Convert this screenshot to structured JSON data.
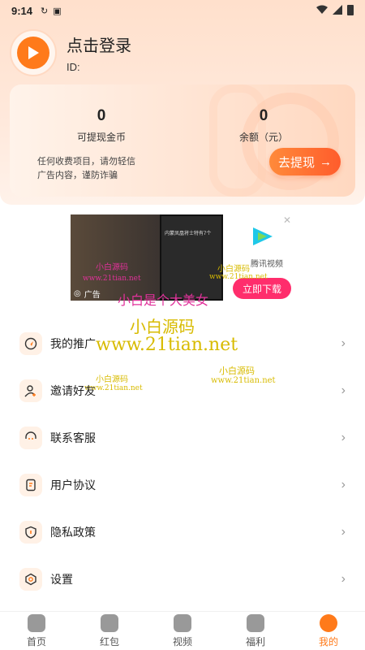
{
  "status_bar": {
    "time": "9:14"
  },
  "profile": {
    "login_text": "点击登录",
    "id_label": "ID:"
  },
  "coin_card": {
    "coins_value": "0",
    "coins_label": "可提现金币",
    "balance_value": "0",
    "balance_label": "余额（元）",
    "notice_line1": "任何收费项目，请勿轻信",
    "notice_line2": "广告内容，谨防诈骗",
    "withdraw_label": "去提现"
  },
  "ad": {
    "badge": "广告",
    "app_name": "腾讯视频",
    "download_label": "立即下载",
    "phone_text": "内蒙凤凰将士特有7个"
  },
  "watermarks": {
    "w1": "小白源码",
    "w2": "www.21tian.net",
    "w3": "小白是个大美女",
    "w6": "小白源码",
    "w7": "www.21tian.net"
  },
  "menu": {
    "items": [
      {
        "label": "我的推广",
        "icon": "send-icon"
      },
      {
        "label": "邀请好友",
        "icon": "add-user-icon"
      },
      {
        "label": "联系客服",
        "icon": "headset-icon"
      },
      {
        "label": "用户协议",
        "icon": "document-icon"
      },
      {
        "label": "隐私政策",
        "icon": "shield-icon"
      },
      {
        "label": "设置",
        "icon": "settings-icon"
      }
    ]
  },
  "tabs": [
    {
      "label": "首页",
      "icon": "home-icon"
    },
    {
      "label": "红包",
      "icon": "red-envelope-icon"
    },
    {
      "label": "视频",
      "icon": "video-icon"
    },
    {
      "label": "福利",
      "icon": "gift-icon"
    },
    {
      "label": "我的",
      "icon": "user-icon"
    }
  ],
  "colors": {
    "accent": "#ff7a1a",
    "header_bg": "#ffe4d4",
    "download_btn": "#ff2d6c"
  }
}
